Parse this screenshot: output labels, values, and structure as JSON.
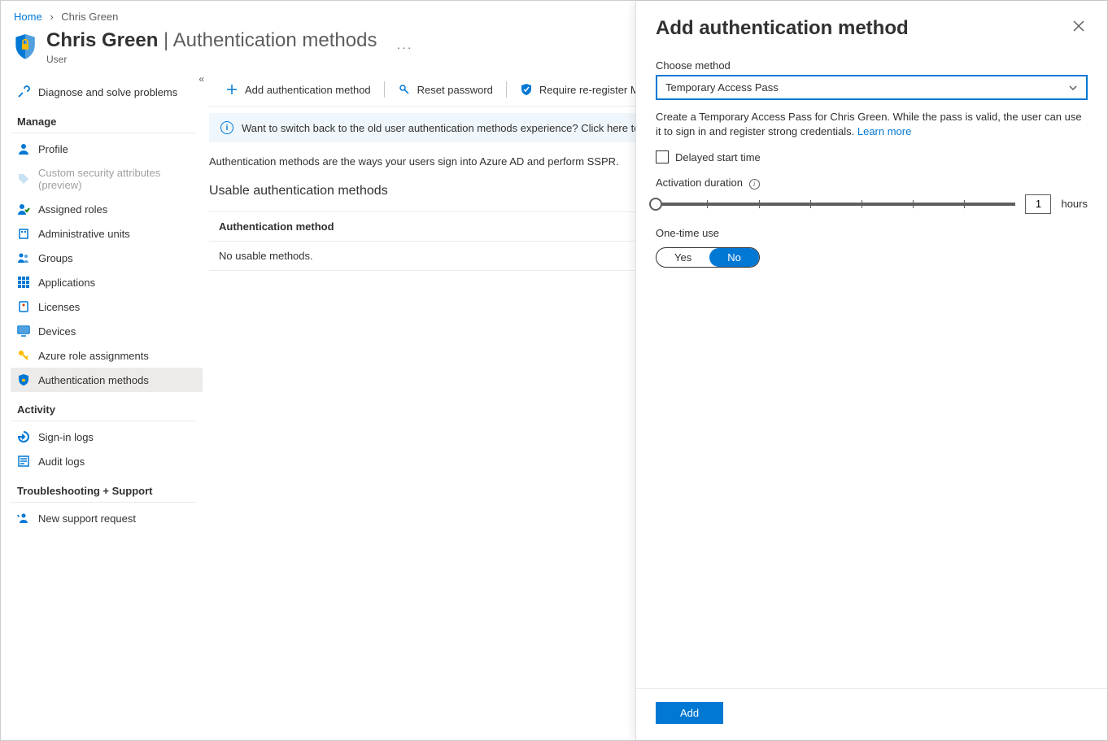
{
  "breadcrumb": {
    "home": "Home",
    "current": "Chris Green"
  },
  "header": {
    "title_strong": "Chris Green",
    "title_sep": " | ",
    "title_thin": "Authentication methods",
    "subtitle": "User"
  },
  "sidebar": {
    "diagnose": "Diagnose and solve problems",
    "sec_manage": "Manage",
    "profile": "Profile",
    "custom_attrs": "Custom security attributes (preview)",
    "assigned_roles": "Assigned roles",
    "admin_units": "Administrative units",
    "groups": "Groups",
    "applications": "Applications",
    "licenses": "Licenses",
    "devices": "Devices",
    "azure_roles": "Azure role assignments",
    "auth_methods": "Authentication methods",
    "sec_activity": "Activity",
    "signin_logs": "Sign-in logs",
    "audit_logs": "Audit logs",
    "sec_trouble": "Troubleshooting + Support",
    "new_support": "New support request"
  },
  "toolbar": {
    "add": "Add authentication method",
    "reset": "Reset password",
    "require": "Require re-register M"
  },
  "banner": "Want to switch back to the old user authentication methods experience? Click here to",
  "main": {
    "intro": "Authentication methods are the ways your users sign into Azure AD and perform SSPR.",
    "usable_h": "Usable authentication methods",
    "col_method": "Authentication method",
    "none": "No usable methods."
  },
  "panel": {
    "title": "Add authentication method",
    "choose_label": "Choose method",
    "choose_value": "Temporary Access Pass",
    "help": "Create a Temporary Access Pass for Chris Green. While the pass is valid, the user can use it to sign in and register strong credentials. ",
    "learn_more": "Learn more",
    "delayed": "Delayed start time",
    "activation": "Activation duration",
    "duration_value": "1",
    "hours": "hours",
    "onetime": "One-time use",
    "yes": "Yes",
    "no": "No",
    "add_btn": "Add"
  }
}
